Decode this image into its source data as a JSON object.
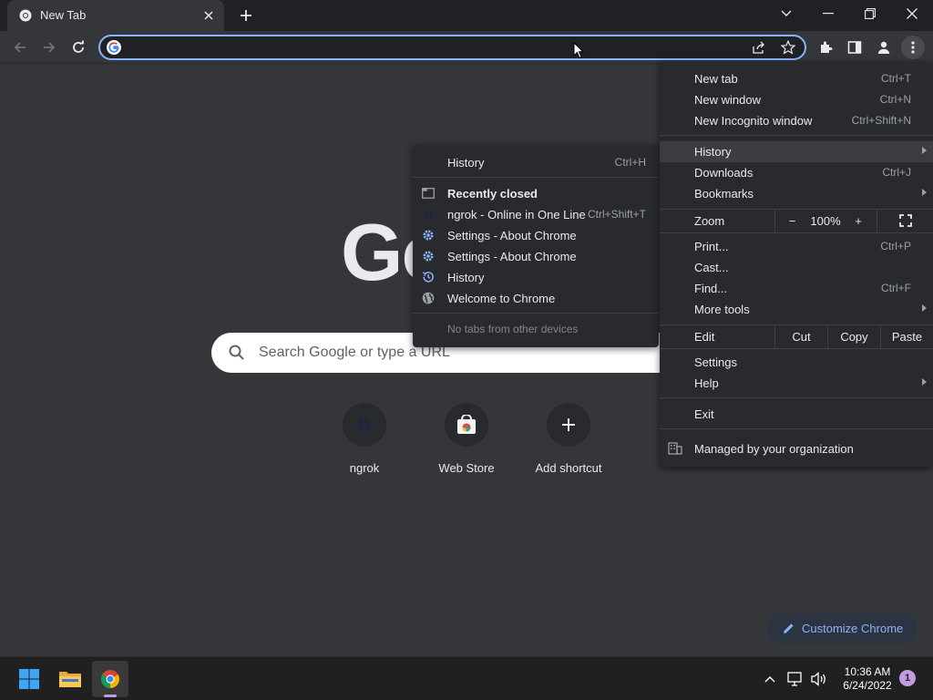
{
  "tab": {
    "title": "New Tab"
  },
  "omnibox": {
    "value": ""
  },
  "ntp": {
    "logo_text": "Go",
    "search_placeholder": "Search Google or type a URL",
    "shortcuts": [
      {
        "label": "ngrok"
      },
      {
        "label": "Web Store"
      },
      {
        "label": "Add shortcut"
      }
    ],
    "customize_label": "Customize Chrome"
  },
  "main_menu": {
    "new_tab": {
      "label": "New tab",
      "shortcut": "Ctrl+T"
    },
    "new_window": {
      "label": "New window",
      "shortcut": "Ctrl+N"
    },
    "new_incognito": {
      "label": "New Incognito window",
      "shortcut": "Ctrl+Shift+N"
    },
    "history": {
      "label": "History"
    },
    "downloads": {
      "label": "Downloads",
      "shortcut": "Ctrl+J"
    },
    "bookmarks": {
      "label": "Bookmarks"
    },
    "zoom": {
      "label": "Zoom",
      "minus": "−",
      "value": "100%",
      "plus": "+"
    },
    "print": {
      "label": "Print...",
      "shortcut": "Ctrl+P"
    },
    "cast": {
      "label": "Cast..."
    },
    "find": {
      "label": "Find...",
      "shortcut": "Ctrl+F"
    },
    "more_tools": {
      "label": "More tools"
    },
    "edit": {
      "label": "Edit",
      "cut": "Cut",
      "copy": "Copy",
      "paste": "Paste"
    },
    "settings": {
      "label": "Settings"
    },
    "help": {
      "label": "Help"
    },
    "exit": {
      "label": "Exit"
    },
    "managed": {
      "label": "Managed by your organization"
    }
  },
  "history_menu": {
    "history": {
      "label": "History",
      "shortcut": "Ctrl+H"
    },
    "recently_closed": "Recently closed",
    "items": [
      {
        "label": "ngrok - Online in One Line",
        "shortcut": "Ctrl+Shift+T",
        "icon": "ngrok-icon"
      },
      {
        "label": "Settings - About Chrome",
        "icon": "settings-gear-icon"
      },
      {
        "label": "Settings - About Chrome",
        "icon": "settings-gear-icon"
      },
      {
        "label": "History",
        "icon": "history-clock-icon"
      },
      {
        "label": "Welcome to Chrome",
        "icon": "globe-icon"
      }
    ],
    "no_tabs": "No tabs from other devices"
  },
  "taskbar": {
    "time": "10:36 AM",
    "date": "6/24/2022",
    "notification_count": "1"
  },
  "colors": {
    "background": "#35363a",
    "tabstrip": "#202124",
    "menu": "#292a2d",
    "accent": "#8ab4f8",
    "taskbar": "#202020"
  }
}
